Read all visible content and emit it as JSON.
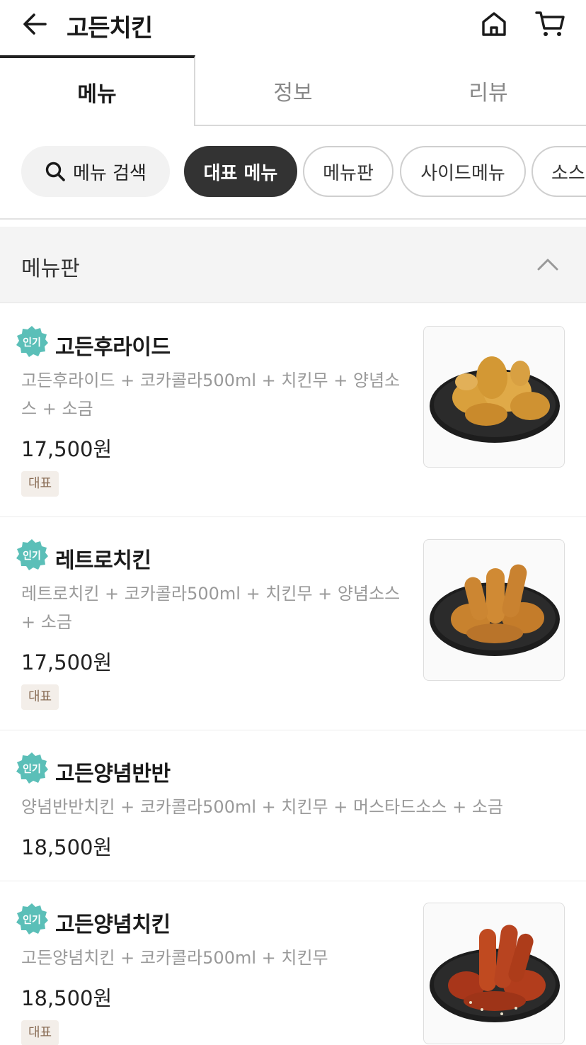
{
  "header": {
    "title": "고든치킨",
    "back_icon": "arrow-left-icon",
    "home_icon": "home-icon",
    "cart_icon": "cart-icon"
  },
  "tabs": [
    {
      "label": "메뉴",
      "active": true
    },
    {
      "label": "정보",
      "active": false
    },
    {
      "label": "리뷰",
      "active": false
    }
  ],
  "chips": {
    "search_label": "메뉴 검색",
    "items": [
      "대표 메뉴",
      "메뉴판",
      "사이드메뉴",
      "소스"
    ],
    "selected": "대표 메뉴"
  },
  "section": {
    "title": "메뉴판",
    "icon": "chevron-up-icon"
  },
  "badge_label": "인기",
  "tag_label": "대표",
  "items": [
    {
      "name": "고든후라이드",
      "desc": "고든후라이드 + 코카콜라500ml + 치킨무 + 양념소스 + 소금",
      "price": "17,500원",
      "tag": "대표",
      "photo": "fried-chicken-photo"
    },
    {
      "name": "레트로치킨",
      "desc": "레트로치킨 + 코카콜라500ml + 치킨무 + 양념소스 + 소금",
      "price": "17,500원",
      "tag": "대표",
      "photo": "retro-chicken-photo"
    },
    {
      "name": "고든양념반반",
      "desc": "양념반반치킨 + 코카콜라500ml + 치킨무 + 머스타드소스 + 소금",
      "price": "18,500원",
      "tag": "",
      "photo": ""
    },
    {
      "name": "고든양념치킨",
      "desc": "고든양념치킨 + 코카콜라500ml + 치킨무",
      "price": "18,500원",
      "tag": "대표",
      "photo": "seasoned-chicken-photo"
    }
  ]
}
